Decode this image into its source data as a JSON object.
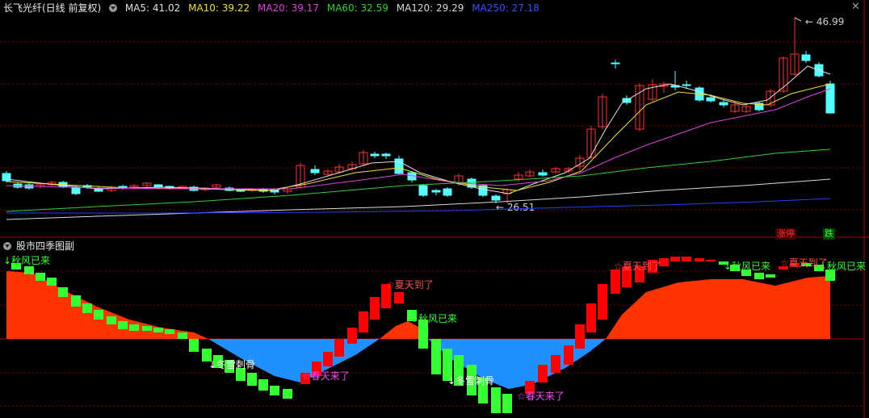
{
  "header": {
    "stock_title": "长飞光纤(日线 前复权)",
    "ma_items": [
      {
        "label": "MA5: 41.02",
        "color": "#e0e0e0"
      },
      {
        "label": "MA10: 39.22",
        "color": "#f0e030"
      },
      {
        "label": "MA20: 39.17",
        "color": "#e040e0"
      },
      {
        "label": "MA60: 32.59",
        "color": "#30d030"
      },
      {
        "label": "MA120: 29.29",
        "color": "#d8d8d8"
      },
      {
        "label": "MA250: 27.18",
        "color": "#3050ff"
      }
    ]
  },
  "main_panel": {
    "high_label": "46.99",
    "low_label": "26.51",
    "zhang_label": "涨",
    "ting_label": "停",
    "die_label": "跌"
  },
  "sub_panel": {
    "title": "股市四季图副",
    "labels": {
      "autumn": "秋风已来",
      "winter": "冬雪刺骨",
      "spring": "春天来了",
      "summer": "夏天到了"
    }
  },
  "colors": {
    "up": "#ff3030",
    "down": "#54ffff",
    "grid": "#8b0000",
    "warm_area": "#ff3300",
    "cold_area": "#1e90ff",
    "rise_bar": "#ff0000",
    "fall_bar": "#33ff33"
  }
}
